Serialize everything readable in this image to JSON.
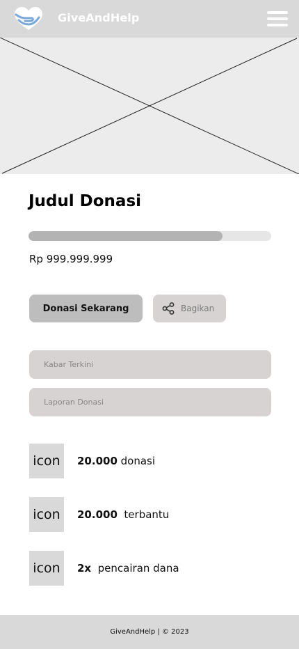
{
  "header": {
    "brand": "GiveAndHelp",
    "logo_icon": "heart-hand-logo-icon",
    "menu_icon": "hamburger-menu-icon"
  },
  "hero": {
    "placeholder_icon": "image-placeholder-icon"
  },
  "campaign": {
    "title": "Judul Donasi",
    "progress_fraction": 0.8,
    "amount": "Rp 999.999.999"
  },
  "actions": {
    "donate_label": "Donasi Sekarang",
    "share_label": "Bagikan",
    "share_icon": "share-icon"
  },
  "tabs": [
    {
      "label": "Kabar Terkini"
    },
    {
      "label": "Laporan Donasi"
    }
  ],
  "stats": [
    {
      "icon_label": "icon",
      "value": "20.000",
      "text": " donasi"
    },
    {
      "icon_label": "icon",
      "value": "20.000",
      "text": "  terbantu"
    },
    {
      "icon_label": "icon",
      "value": "2x",
      "text": "  pencairan dana"
    }
  ],
  "footer": {
    "text": "GiveAndHelp | © 2023"
  },
  "colors": {
    "header_bg": "#d9d9d9",
    "progress_fill": "#b3b3b3",
    "progress_track": "#e6e6e6",
    "donate_button_bg": "#bdbdbd",
    "secondary_bg": "#d7d3d3"
  }
}
